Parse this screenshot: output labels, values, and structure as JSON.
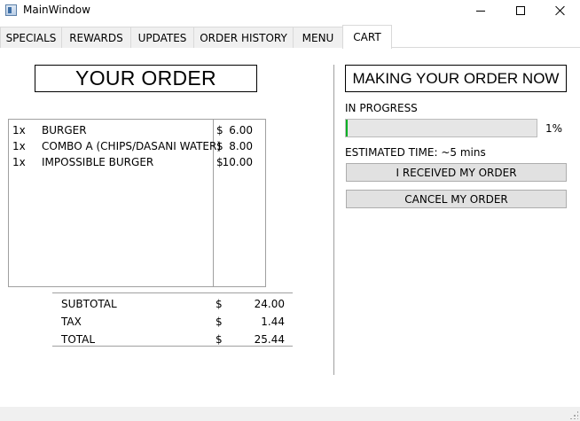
{
  "window": {
    "title": "MainWindow",
    "icon": "app-window-icon",
    "controls": [
      "minimize-icon",
      "maximize-icon",
      "close-icon"
    ]
  },
  "tabs": [
    {
      "label": "SPECIALS",
      "active": false
    },
    {
      "label": "REWARDS",
      "active": false
    },
    {
      "label": "UPDATES",
      "active": false
    },
    {
      "label": "ORDER HISTORY",
      "active": false
    },
    {
      "label": "MENU",
      "active": false
    },
    {
      "label": "CART",
      "active": true
    }
  ],
  "order": {
    "heading": "YOUR ORDER",
    "items": [
      {
        "qty": "1x",
        "name": "BURGER",
        "currency": "$",
        "price": "6.00"
      },
      {
        "qty": "1x",
        "name": "COMBO A (CHIPS/DASANI WATER)",
        "currency": "$",
        "price": "8.00"
      },
      {
        "qty": "1x",
        "name": "IMPOSSIBLE BURGER",
        "currency": "$",
        "price": "10.00"
      }
    ],
    "totals": [
      {
        "label": "SUBTOTAL",
        "currency": "$",
        "amount": "24.00"
      },
      {
        "label": "TAX",
        "currency": "$",
        "amount": "1.44"
      },
      {
        "label": "TOTAL",
        "currency": "$",
        "amount": "25.44"
      }
    ]
  },
  "status": {
    "heading": "MAKING YOUR ORDER NOW",
    "state_label": "IN PROGRESS",
    "progress_fraction": 0.01,
    "progress_text": "1%",
    "progress_color": "#06b025",
    "estimated_time": "ESTIMATED TIME: ~5 mins",
    "received_button": "I RECEIVED MY ORDER",
    "cancel_button": "CANCEL MY ORDER"
  }
}
